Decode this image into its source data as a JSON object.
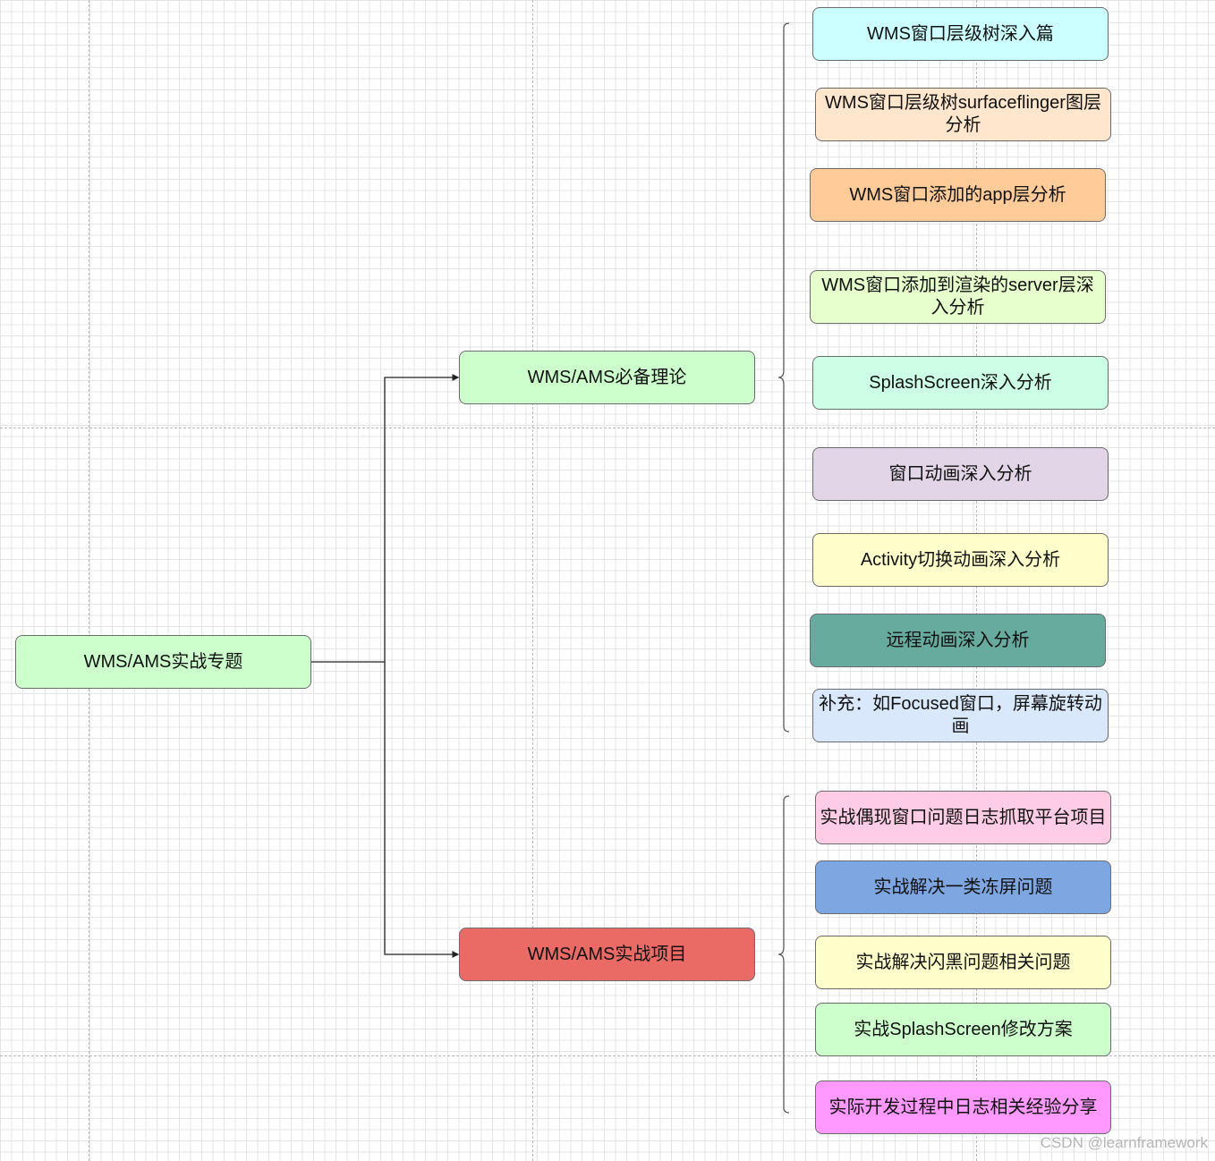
{
  "root": {
    "label": "WMS/AMS实战专题",
    "color": "#ccffcc"
  },
  "branches": [
    {
      "label": "WMS/AMS必备理论",
      "color": "#ccffcc",
      "children": [
        {
          "label": "WMS窗口层级树深入篇",
          "color": "#ccffff"
        },
        {
          "label": "WMS窗口层级树surfaceflinger图层分析",
          "color": "#ffe6cc"
        },
        {
          "label": "WMS窗口添加的app层分析",
          "color": "#ffcc99"
        },
        {
          "label": "WMS窗口添加到渲染的server层深入分析",
          "color": "#e6ffcc"
        },
        {
          "label": "SplashScreen深入分析",
          "color": "#ccffe6"
        },
        {
          "label": "窗口动画深入分析",
          "color": "#e1d5e7"
        },
        {
          "label": "Activity切换动画深入分析",
          "color": "#ffffcc"
        },
        {
          "label": "远程动画深入分析",
          "color": "#67ab9f"
        },
        {
          "label": "补充：如Focused窗口，屏幕旋转动画",
          "color": "#dae8fc"
        }
      ]
    },
    {
      "label": "WMS/AMS实战项目",
      "color": "#ea6b66",
      "children": [
        {
          "label": "实战偶现窗口问题日志抓取平台项目",
          "color": "#ffcce6"
        },
        {
          "label": "实战解决一类冻屏问题",
          "color": "#7ea6e0"
        },
        {
          "label": "实战解决闪黑问题相关问题",
          "color": "#ffffcc"
        },
        {
          "label": "实战SplashScreen修改方案",
          "color": "#ccffcc"
        },
        {
          "label": "实际开发过程中日志相关经验分享",
          "color": "#ff99ff"
        }
      ]
    }
  ],
  "watermark": "CSDN @learnframework"
}
